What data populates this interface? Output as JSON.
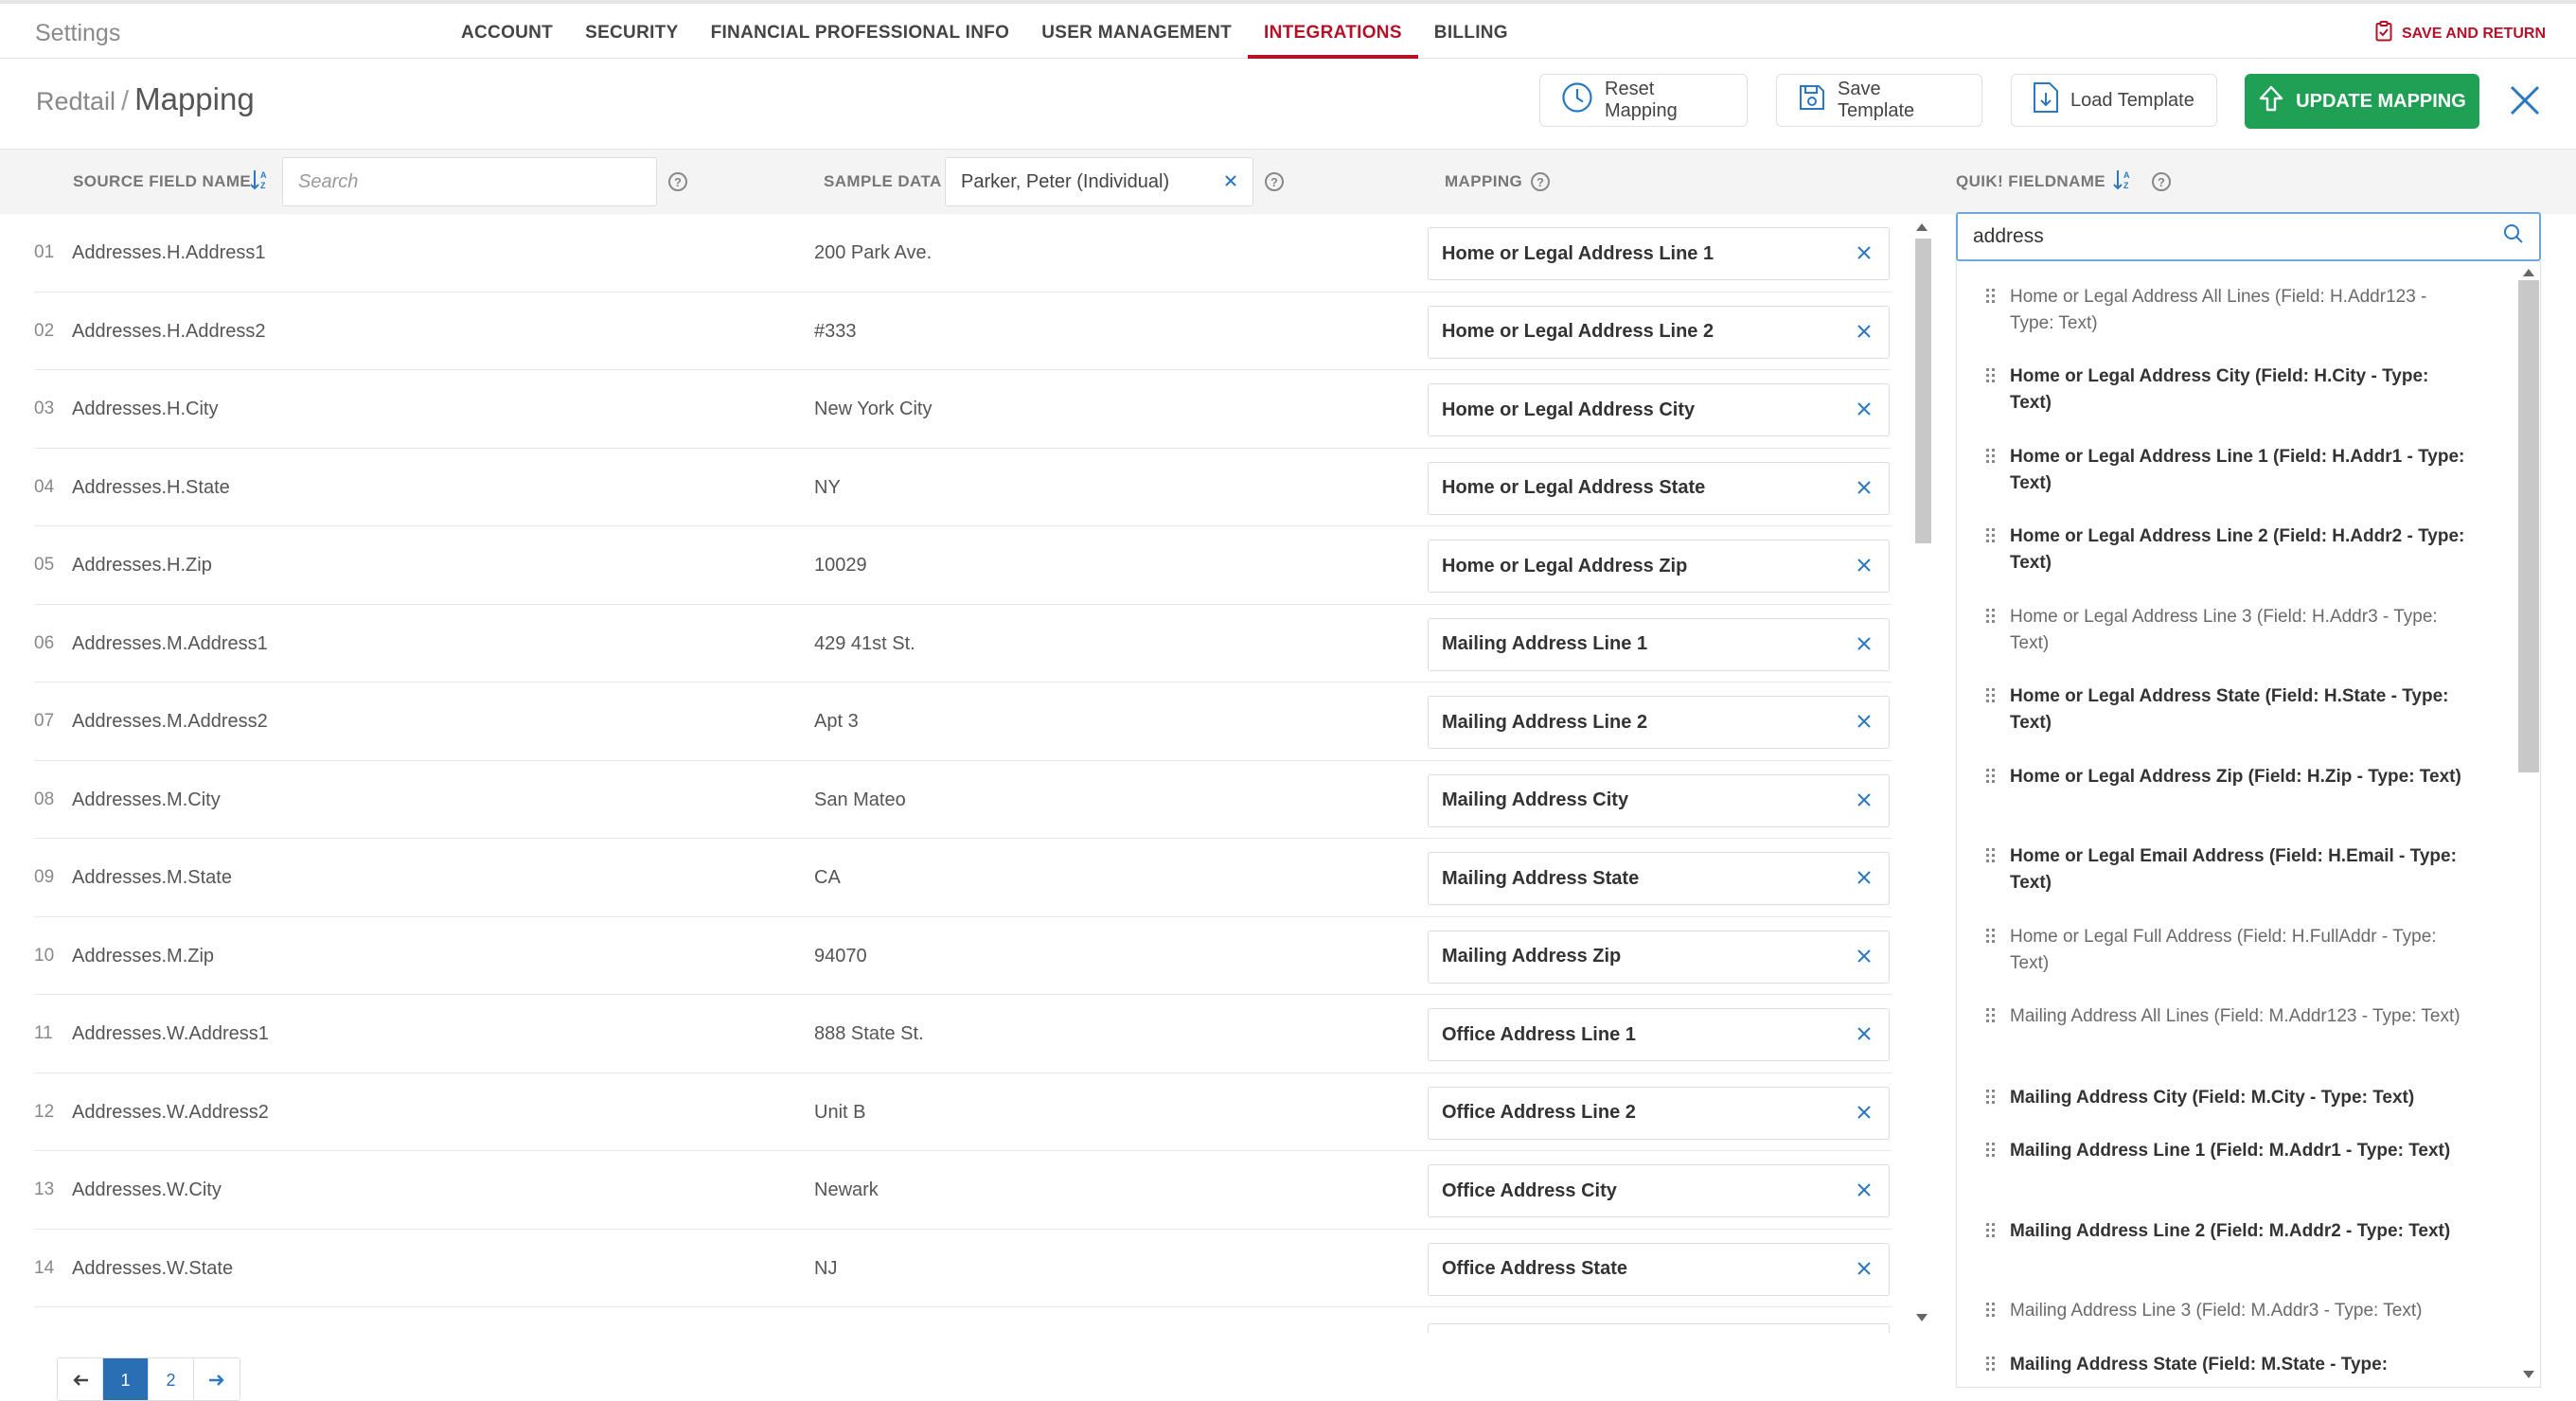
{
  "app": {
    "title": "Settings"
  },
  "nav": {
    "tabs": [
      {
        "label": "ACCOUNT"
      },
      {
        "label": "SECURITY"
      },
      {
        "label": "FINANCIAL PROFESSIONAL INFO"
      },
      {
        "label": "USER MANAGEMENT"
      },
      {
        "label": "INTEGRATIONS",
        "active": true
      },
      {
        "label": "BILLING"
      }
    ],
    "save_return": "SAVE AND RETURN"
  },
  "header": {
    "breadcrumb_parent": "Redtail",
    "separator": "/",
    "title": "Mapping",
    "reset_label": "Reset Mapping",
    "save_template_label": "Save Template",
    "load_template_label": "Load Template",
    "update_label": "UPDATE MAPPING"
  },
  "columns": {
    "source": "SOURCE FIELD NAME",
    "search_placeholder": "Search",
    "sample": "SAMPLE DATA",
    "sample_value": "Parker, Peter (Individual)",
    "mapping": "MAPPING",
    "quik": "QUIK! FIELDNAME"
  },
  "rows": [
    {
      "num": "01",
      "source": "Addresses.H.Address1",
      "sample": "200 Park Ave.",
      "mapping": "Home or Legal Address Line 1"
    },
    {
      "num": "02",
      "source": "Addresses.H.Address2",
      "sample": "#333",
      "mapping": "Home or Legal Address Line 2"
    },
    {
      "num": "03",
      "source": "Addresses.H.City",
      "sample": "New York City",
      "mapping": "Home or Legal Address City"
    },
    {
      "num": "04",
      "source": "Addresses.H.State",
      "sample": "NY",
      "mapping": "Home or Legal Address State"
    },
    {
      "num": "05",
      "source": "Addresses.H.Zip",
      "sample": "10029",
      "mapping": "Home or Legal Address Zip"
    },
    {
      "num": "06",
      "source": "Addresses.M.Address1",
      "sample": "429 41st St.",
      "mapping": "Mailing Address Line 1"
    },
    {
      "num": "07",
      "source": "Addresses.M.Address2",
      "sample": "Apt 3",
      "mapping": "Mailing Address Line 2"
    },
    {
      "num": "08",
      "source": "Addresses.M.City",
      "sample": "San Mateo",
      "mapping": "Mailing Address City"
    },
    {
      "num": "09",
      "source": "Addresses.M.State",
      "sample": "CA",
      "mapping": "Mailing Address State"
    },
    {
      "num": "10",
      "source": "Addresses.M.Zip",
      "sample": "94070",
      "mapping": "Mailing Address Zip"
    },
    {
      "num": "11",
      "source": "Addresses.W.Address1",
      "sample": "888 State St.",
      "mapping": "Office Address Line 1"
    },
    {
      "num": "12",
      "source": "Addresses.W.Address2",
      "sample": "Unit B",
      "mapping": "Office Address Line 2"
    },
    {
      "num": "13",
      "source": "Addresses.W.City",
      "sample": "Newark",
      "mapping": "Office Address City"
    },
    {
      "num": "14",
      "source": "Addresses.W.State",
      "sample": "NJ",
      "mapping": "Office Address State"
    }
  ],
  "pagination": {
    "pages": [
      "1",
      "2"
    ],
    "current": "1"
  },
  "quik_panel": {
    "search_value": "address",
    "items": [
      {
        "text": "Home or Legal Address All Lines (Field: H.Addr123 - Type: Text)",
        "bold": false
      },
      {
        "text": "Home or Legal Address City (Field: H.City - Type: Text)",
        "bold": true
      },
      {
        "text": "Home or Legal Address Line 1 (Field: H.Addr1 - Type: Text)",
        "bold": true
      },
      {
        "text": "Home or Legal Address Line 2 (Field: H.Addr2 - Type: Text)",
        "bold": true
      },
      {
        "text": "Home or Legal Address Line 3 (Field: H.Addr3 - Type: Text)",
        "bold": false
      },
      {
        "text": "Home or Legal Address State (Field: H.State - Type: Text)",
        "bold": true
      },
      {
        "text": "Home or Legal Address Zip (Field: H.Zip - Type: Text)",
        "bold": true
      },
      {
        "text": "Home or Legal Email Address (Field: H.Email - Type: Text)",
        "bold": true
      },
      {
        "text": "Home or Legal Full Address (Field: H.FullAddr - Type: Text)",
        "bold": false
      },
      {
        "text": "Mailing Address All Lines (Field: M.Addr123 - Type: Text)",
        "bold": false
      },
      {
        "text": "Mailing Address City (Field: M.City - Type: Text)",
        "bold": true
      },
      {
        "text": "Mailing Address Line 1 (Field: M.Addr1 - Type: Text)",
        "bold": true
      },
      {
        "text": "Mailing Address Line 2 (Field: M.Addr2 - Type: Text)",
        "bold": true
      },
      {
        "text": "Mailing Address Line 3 (Field: M.Addr3 - Type: Text)",
        "bold": false
      },
      {
        "text": "Mailing Address State (Field: M.State - Type:",
        "bold": true
      }
    ]
  },
  "colors": {
    "brand_red": "#b5122a",
    "update_green": "#20a054",
    "link_blue": "#2a6fb3",
    "x_blue": "#2b78c2"
  }
}
